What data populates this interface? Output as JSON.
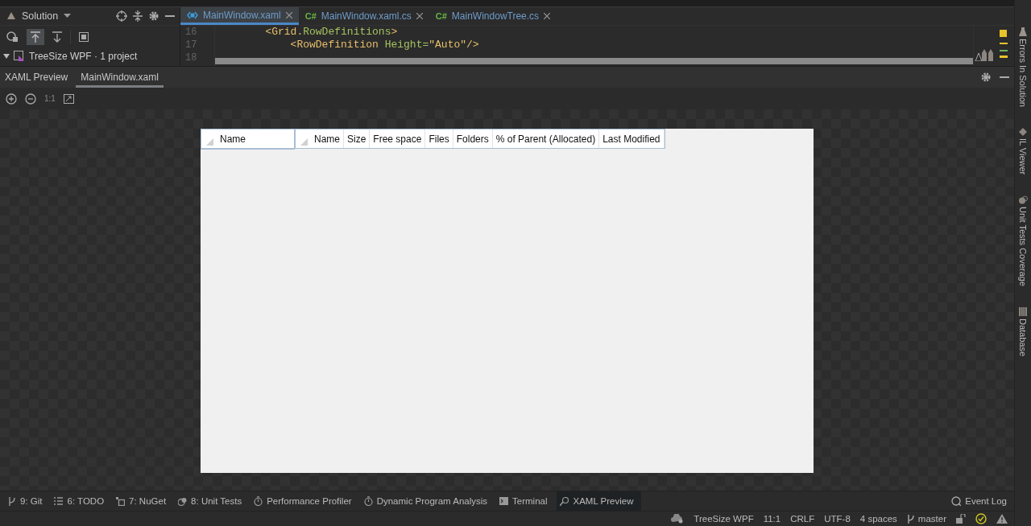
{
  "solution_panel": {
    "title": "Solution",
    "tree": [
      {
        "label": "TreeSize WPF · 1 project",
        "expanded": true
      }
    ]
  },
  "editor_tabs": [
    {
      "label": "MainWindow.xaml",
      "kind": "xaml",
      "selected": true
    },
    {
      "label": "MainWindow.xaml.cs",
      "kind": "csharp",
      "badge": "C#",
      "selected": false
    },
    {
      "label": "MainWindowTree.cs",
      "kind": "csharp",
      "badge": "C#",
      "selected": false
    }
  ],
  "code_lines": [
    {
      "number": "16",
      "tokens": [
        {
          "text": "        <Grid.",
          "kind": "tag"
        },
        {
          "text": "RowDefinitions",
          "kind": "attr"
        },
        {
          "text": ">",
          "kind": "tag"
        }
      ]
    },
    {
      "number": "17",
      "tokens": [
        {
          "text": "            <RowDefinition ",
          "kind": "tag"
        },
        {
          "text": "Height=",
          "kind": "attr"
        },
        {
          "text": "\"Auto\"",
          "kind": "value"
        },
        {
          "text": "/>",
          "kind": "tag"
        }
      ]
    },
    {
      "number": "18"
    }
  ],
  "tool_window": {
    "title": "XAML Preview",
    "tabs": [
      {
        "label": "MainWindow.xaml",
        "selected": true
      }
    ],
    "zoom_reset": "1:1"
  },
  "preview": {
    "tree_header": [
      "Name"
    ],
    "list_header": [
      "Name",
      "Size",
      "Free space",
      "Files",
      "Folders",
      "% of Parent (Allocated)",
      "Last Modified"
    ]
  },
  "side_tabs": [
    {
      "label": "Errors In Solution",
      "kind": "flask"
    },
    {
      "label": "IL Viewer",
      "kind": "diamond"
    },
    {
      "label": "Unit Tests Coverage",
      "kind": "coverage"
    },
    {
      "label": "Database",
      "kind": "database"
    }
  ],
  "bottom_tabs": [
    {
      "label": "9: Git",
      "kind": "git",
      "selected": false
    },
    {
      "label": "6: TODO",
      "kind": "list",
      "selected": false
    },
    {
      "label": "7: NuGet",
      "kind": "nuget",
      "selected": false
    },
    {
      "label": "8: Unit Tests",
      "kind": "tests",
      "selected": false
    },
    {
      "label": "Performance Profiler",
      "kind": "timer",
      "selected": false
    },
    {
      "label": "Dynamic Program Analysis",
      "kind": "timer",
      "selected": false
    },
    {
      "label": "Terminal",
      "kind": "terminal",
      "selected": false
    },
    {
      "label": "XAML Preview",
      "kind": "preview",
      "selected": true
    }
  ],
  "event_log": "Event Log",
  "status_bar": {
    "project": "TreeSize WPF",
    "position": "11:1",
    "line_ending": "CRLF",
    "encoding": "UTF-8",
    "indent": "4 spaces",
    "branch": "master"
  }
}
